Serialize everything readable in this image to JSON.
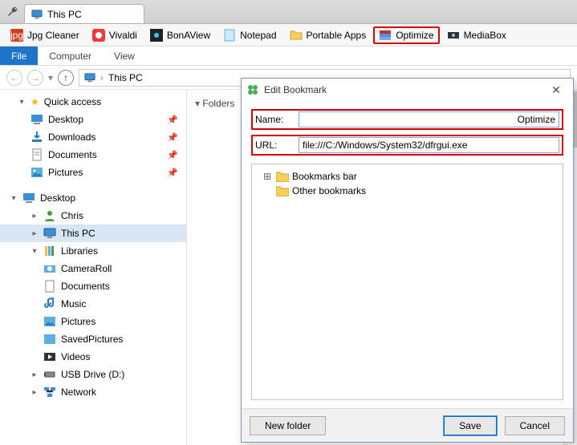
{
  "tab": {
    "title": "This PC"
  },
  "bookmarks": [
    {
      "label": "Jpg Cleaner",
      "color": "#d04020"
    },
    {
      "label": "Vivaldi",
      "color": "#d04020"
    },
    {
      "label": "BonAView",
      "color": "#222222"
    },
    {
      "label": "Notepad",
      "color": "#6ab0e0"
    },
    {
      "label": "Portable Apps",
      "color": "#f0c040"
    },
    {
      "label": "Optimize",
      "color": "#3a70c0",
      "highlight": true
    },
    {
      "label": "MediaBox",
      "color": "#333333"
    }
  ],
  "ribbon": {
    "file": "File",
    "tabs": [
      "Computer",
      "View"
    ]
  },
  "address": {
    "path": "This PC"
  },
  "content": {
    "folders_header": "Folders"
  },
  "tree": {
    "quick": "Quick access",
    "qitems": [
      "Desktop",
      "Downloads",
      "Documents",
      "Pictures"
    ],
    "desktop": "Desktop",
    "chris": "Chris",
    "thispc": "This PC",
    "libraries": "Libraries",
    "libitems": [
      "CameraRoll",
      "Documents",
      "Music",
      "Pictures",
      "SavedPictures",
      "Videos"
    ],
    "usb": "USB Drive (D:)",
    "network": "Network"
  },
  "dialog": {
    "title": "Edit Bookmark",
    "name_label": "Name:",
    "name_value": "Optimize",
    "url_label": "URL:",
    "url_value": "file:///C:/Windows/System32/dfrgui.exe",
    "folders": [
      "Bookmarks bar",
      "Other bookmarks"
    ],
    "new_folder": "New folder",
    "save": "Save",
    "cancel": "Cancel"
  }
}
